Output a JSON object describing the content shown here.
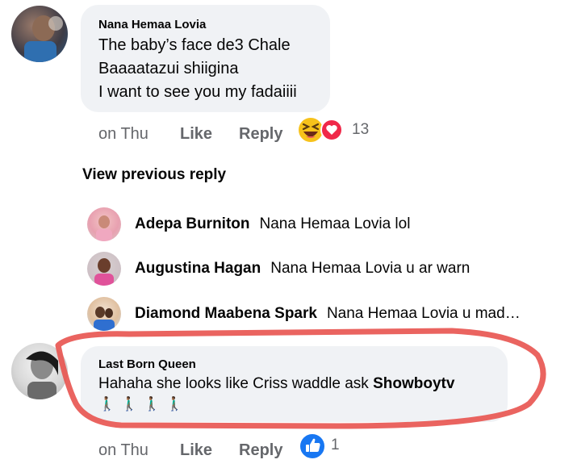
{
  "comment1": {
    "author": "Nana Hemaa Lovia",
    "lines": [
      "The baby’s face de3 Chale",
      "Baaaatazui shiigina",
      "I want to see you my fadaiiii"
    ],
    "time": "on Thu",
    "like": "Like",
    "reply": "Reply",
    "reaction_count": "13",
    "reactions": [
      "laughing-emoji",
      "heart"
    ]
  },
  "view_previous": "View previous reply",
  "replies": [
    {
      "name": "Adepa Burniton",
      "text": "Nana Hemaa Lovia lol"
    },
    {
      "name": "Augustina Hagan",
      "text": "Nana Hemaa Lovia u ar warn"
    },
    {
      "name": "Diamond Maabena Spark",
      "text": "Nana Hemaa Lovia  u mad…"
    }
  ],
  "comment2": {
    "author": "Last Born Queen",
    "text": "Hahaha she looks like Criss waddle ask",
    "mention": "Showboytv",
    "emoji": "🚶🏾‍♂️ 🚶🏾‍♂️ 🚶🏾‍♂️ 🚶🏾‍♂️",
    "time": "on Thu",
    "like": "Like",
    "reply": "Reply",
    "reaction_count": "1",
    "reactions": [
      "thumbs-up"
    ]
  },
  "colors": {
    "bubble": "#f0f2f5",
    "meta": "#65676b",
    "like_blue": "#1877f2",
    "highlight_red": "#e8534f"
  }
}
